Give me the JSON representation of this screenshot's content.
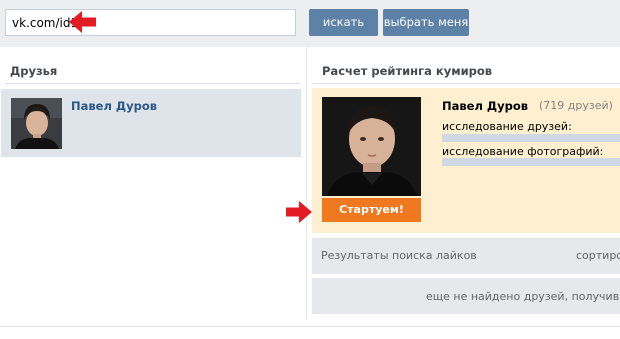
{
  "search": {
    "url_value": "vk.com/id1",
    "search_button": "искать",
    "choose_me_button": "выбрать меня"
  },
  "friends": {
    "title": "Друзья",
    "items": [
      {
        "name": "Павел Дуров"
      }
    ]
  },
  "rating": {
    "title": "Расчет рейтинга кумиров",
    "idol_name": "Павел Дуров",
    "friends_count": "(719 друзей)",
    "friends_research_label": "исследование друзей:",
    "friends_research_progress": 0,
    "photos_research_label": "исследование фотографий:",
    "photos_research_progress": 0,
    "start_button": "Стартуем!"
  },
  "results": {
    "likes_label": "Результаты поиска лайков",
    "sort_label": "сортиро",
    "not_found_text": "еще не найдено друзей, получивш"
  },
  "colors": {
    "accent": "#5e81a8",
    "start_button": "#f0781e",
    "card_background": "#fdefd0",
    "annotation_arrow": "#e31b23"
  }
}
